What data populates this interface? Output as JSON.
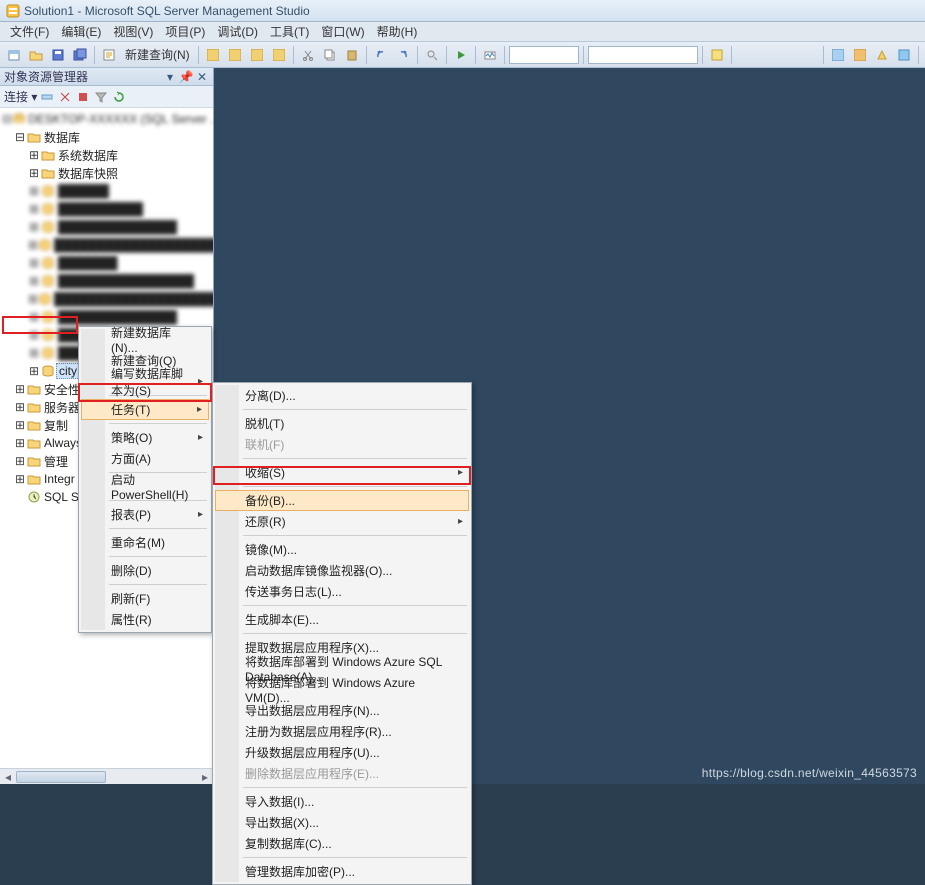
{
  "title": "Solution1 - Microsoft SQL Server Management Studio",
  "menubar": [
    "文件(F)",
    "编辑(E)",
    "视图(V)",
    "项目(P)",
    "调试(D)",
    "工具(T)",
    "窗口(W)",
    "帮助(H)"
  ],
  "toolbar": {
    "new_query": "新建查询(N)"
  },
  "object_explorer": {
    "header": "对象资源管理器",
    "connect_label": "连接 ▾"
  },
  "tree": {
    "server_blur": "DESKTOP-XXXXXX (SQL Server ...)",
    "databases": "数据库",
    "system_db": "系统数据库",
    "db_snapshot": "数据库快照",
    "blur_items": [
      "██████",
      "██████████",
      "██████████████",
      "█████████████████████",
      "███████",
      "████████████████",
      "████████████████████",
      "██████████████",
      "██████",
      "███████████████"
    ],
    "selected_db": "city",
    "security": "安全性",
    "server_objects": "服务器",
    "replication": "复制",
    "alwayson": "Always",
    "management": "管理",
    "integration": "Integr",
    "sqlagent": "SQL S"
  },
  "ctx1": {
    "items": [
      {
        "label": "新建数据库(N)..."
      },
      {
        "label": "新建查询(Q)"
      },
      {
        "label": "编写数据库脚本为(S)",
        "arrow": true
      },
      {
        "sep": true
      },
      {
        "label": "任务(T)",
        "arrow": true,
        "highlight": true
      },
      {
        "sep": true
      },
      {
        "label": "策略(O)",
        "arrow": true
      },
      {
        "label": "方面(A)"
      },
      {
        "sep": true
      },
      {
        "label": "启动 PowerShell(H)"
      },
      {
        "sep": true
      },
      {
        "label": "报表(P)",
        "arrow": true
      },
      {
        "sep": true
      },
      {
        "label": "重命名(M)"
      },
      {
        "sep": true
      },
      {
        "label": "删除(D)"
      },
      {
        "sep": true
      },
      {
        "label": "刷新(F)"
      },
      {
        "label": "属性(R)"
      }
    ]
  },
  "ctx2": {
    "items": [
      {
        "label": "分离(D)..."
      },
      {
        "sep": true
      },
      {
        "label": "脱机(T)"
      },
      {
        "label": "联机(F)",
        "disabled": true
      },
      {
        "sep": true
      },
      {
        "label": "收缩(S)",
        "arrow": true
      },
      {
        "sep": true
      },
      {
        "label": "备份(B)...",
        "highlight": true
      },
      {
        "label": "还原(R)",
        "arrow": true
      },
      {
        "sep": true
      },
      {
        "label": "镜像(M)..."
      },
      {
        "label": "启动数据库镜像监视器(O)..."
      },
      {
        "label": "传送事务日志(L)..."
      },
      {
        "sep": true
      },
      {
        "label": "生成脚本(E)..."
      },
      {
        "sep": true
      },
      {
        "label": "提取数据层应用程序(X)..."
      },
      {
        "label": "将数据库部署到 Windows Azure SQL Database(A)..."
      },
      {
        "label": "将数据库部署到 Windows Azure VM(D)..."
      },
      {
        "label": "导出数据层应用程序(N)..."
      },
      {
        "label": "注册为数据层应用程序(R)..."
      },
      {
        "label": "升级数据层应用程序(U)..."
      },
      {
        "label": "删除数据层应用程序(E)...",
        "disabled": true
      },
      {
        "sep": true
      },
      {
        "label": "导入数据(I)..."
      },
      {
        "label": "导出数据(X)..."
      },
      {
        "label": "复制数据库(C)..."
      },
      {
        "sep": true
      },
      {
        "label": "管理数据库加密(P)..."
      }
    ]
  },
  "watermark": "https://blog.csdn.net/weixin_44563573"
}
